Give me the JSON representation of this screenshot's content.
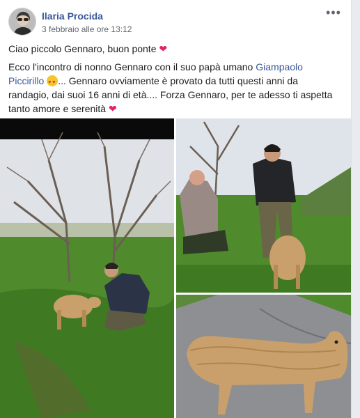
{
  "post": {
    "author": "Ilaria Procida",
    "timestamp": "3 febbraio alle ore 13:12",
    "more_icon": "more-icon"
  },
  "body": {
    "line1": "Ciao piccolo Gennaro, buon ponte",
    "p2_start": "Ecco l'incontro di nonno Gennaro con il suo papà umano ",
    "p2_link": "Giampaolo Piccirillo",
    "p2_rest": "... Gennaro ovviamente è provato da tutti questi anni da randagio, dai suoi 16 anni di età.... Forza Gennaro, per te adesso ti aspetta tanto amore e serenità",
    "heart_icon": "heart-icon",
    "emoji_icon": "heart-eyes-emoji-icon"
  },
  "photos": {
    "count": 3,
    "colors": {
      "grass": "#4f8a2c",
      "sky": "#dfe4ea",
      "road": "#8e8f92",
      "dog": "#c9a06b"
    }
  }
}
